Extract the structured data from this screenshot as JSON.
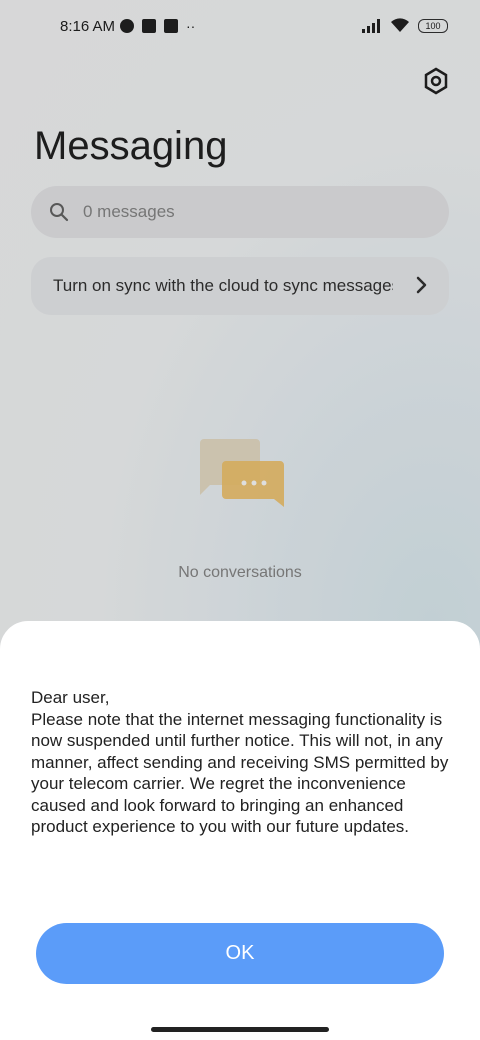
{
  "status_bar": {
    "time": "8:16 AM",
    "battery": "100"
  },
  "header": {
    "title": "Messaging",
    "settings_icon": "gear-icon"
  },
  "search": {
    "placeholder": "0 messages"
  },
  "sync_banner": {
    "text": "Turn on sync with the cloud to sync messages"
  },
  "empty_state": {
    "text": "No conversations"
  },
  "dialog": {
    "message": "Dear user,\nPlease note that the internet messaging functionality is now suspended until further notice. This will not, in any manner, affect sending and receiving SMS permitted by your telecom carrier. We regret the inconvenience caused and look forward to bringing an enhanced product experience to you with our future updates.",
    "ok_label": "OK"
  },
  "colors": {
    "accent": "#5b9cf9",
    "illustration_back": "#eadfc8",
    "illustration_front": "#f4c56a"
  }
}
